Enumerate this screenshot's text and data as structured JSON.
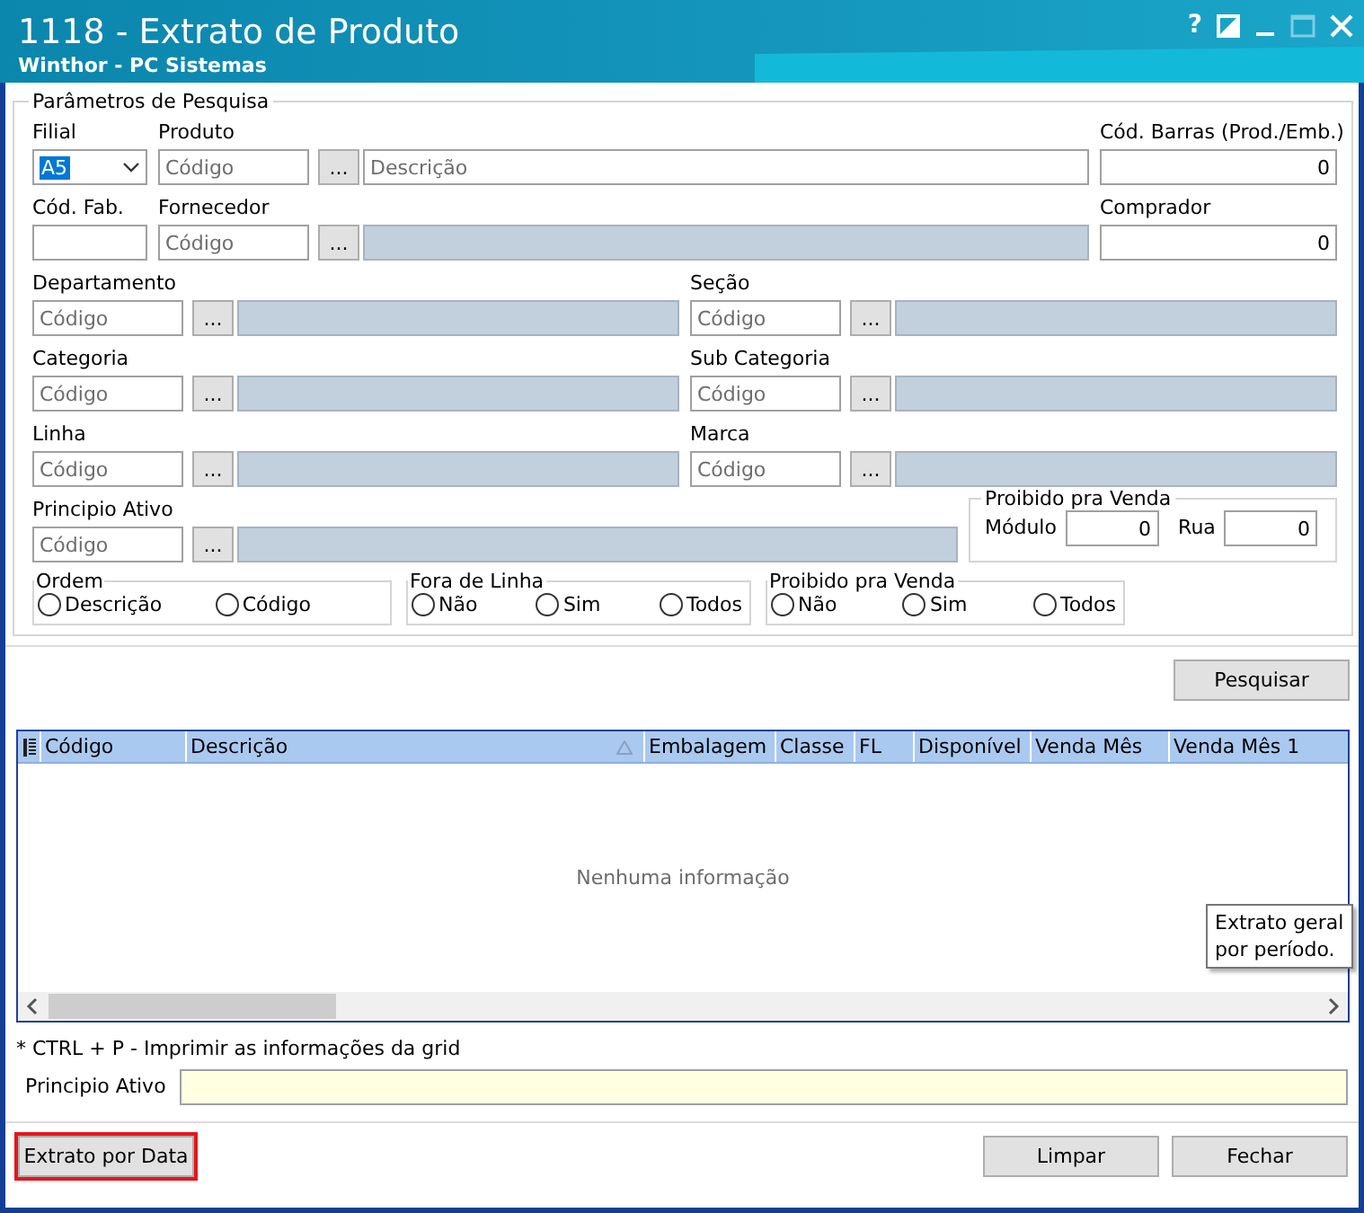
{
  "window": {
    "title": "1118 - Extrato de Produto",
    "subtitle": "Winthor - PC Sistemas",
    "help": "?"
  },
  "filters": {
    "title": "Parâmetros de Pesquisa",
    "rows": [
      {
        "fields": [
          {
            "kind": "select",
            "label": "Filial",
            "value": "A5",
            "text_selected": true
          },
          {
            "kind": "lookup",
            "label": "Produto",
            "code_placeholder": "Código",
            "button": "...",
            "description_placeholder": "Descrição",
            "description_enabled": true
          },
          {
            "kind": "number",
            "label": "Cód. Barras (Prod./Emb.)",
            "value": "0"
          }
        ]
      },
      {
        "fields": [
          {
            "kind": "text",
            "label": "Cód. Fab."
          },
          {
            "kind": "lookup",
            "label": "Fornecedor",
            "code_placeholder": "Código",
            "button": "...",
            "description_enabled": false
          },
          {
            "kind": "number",
            "label": "Comprador",
            "value": "0"
          }
        ]
      },
      {
        "fields": [
          {
            "kind": "lookup",
            "label": "Departamento",
            "code_placeholder": "Código",
            "button": "...",
            "description_enabled": false
          },
          {
            "kind": "lookup",
            "label": "Seção",
            "code_placeholder": "Código",
            "button": "...",
            "description_enabled": false
          }
        ]
      },
      {
        "fields": [
          {
            "kind": "lookup",
            "label": "Categoria",
            "code_placeholder": "Código",
            "button": "...",
            "description_enabled": false
          },
          {
            "kind": "lookup",
            "label": "Sub Categoria",
            "code_placeholder": "Código",
            "button": "...",
            "description_enabled": false
          }
        ]
      },
      {
        "fields": [
          {
            "kind": "lookup",
            "label": "Linha",
            "code_placeholder": "Código",
            "button": "...",
            "description_enabled": false
          },
          {
            "kind": "lookup",
            "label": "Marca",
            "code_placeholder": "Código",
            "button": "...",
            "description_enabled": false
          }
        ]
      },
      {
        "fields": [
          {
            "kind": "lookup",
            "label": "Principio Ativo",
            "code_placeholder": "Código",
            "button": "...",
            "description_enabled": false
          },
          {
            "kind": "group",
            "title": "Proibido pra Venda",
            "fields": [
              {
                "label": "Módulo",
                "value": "0"
              },
              {
                "label": "Rua",
                "value": "0"
              }
            ]
          }
        ]
      }
    ],
    "radio_groups": [
      {
        "title": "Ordem",
        "options": [
          {
            "label": "Descrição",
            "selected": false
          },
          {
            "label": "Código",
            "selected": false
          }
        ]
      },
      {
        "title": "Fora de Linha",
        "options": [
          {
            "label": "Não",
            "selected": false
          },
          {
            "label": "Sim",
            "selected": false
          },
          {
            "label": "Todos",
            "selected": false
          }
        ]
      },
      {
        "title": "Proibido pra Venda",
        "options": [
          {
            "label": "Não",
            "selected": false
          },
          {
            "label": "Sim",
            "selected": false
          },
          {
            "label": "Todos",
            "selected": false
          }
        ]
      }
    ]
  },
  "search_button": "Pesquisar",
  "grid": {
    "columns": [
      {
        "label": "Código",
        "sorted": false
      },
      {
        "label": "Descrição",
        "sorted": true
      },
      {
        "label": "Embalagem",
        "sorted": false
      },
      {
        "label": "Classe",
        "sorted": false
      },
      {
        "label": "FL",
        "sorted": false
      },
      {
        "label": "Disponível",
        "sorted": false
      },
      {
        "label": "Venda Mês",
        "sorted": false
      },
      {
        "label": "Venda Mês 1",
        "sorted": false
      }
    ],
    "empty_message": "Nenhuma informação",
    "tooltip": [
      "Extrato geral",
      "por período."
    ]
  },
  "footnote": "* CTRL + P - Imprimir as informações da grid",
  "principio_ativo": {
    "label": "Principio Ativo"
  },
  "buttons": [
    {
      "label": "Extrato por Data",
      "highlighted": true
    },
    {
      "label": "Limpar",
      "highlighted": false
    },
    {
      "label": "Fechar",
      "highlighted": false
    }
  ]
}
